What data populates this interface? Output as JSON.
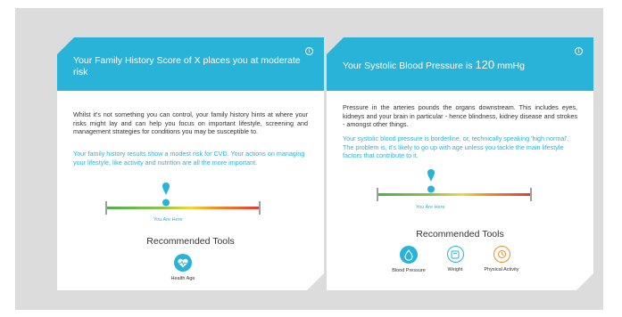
{
  "colors": {
    "accent": "#29b3d8",
    "panel_bg": "#dcdcdc",
    "card_bg": "#ffffff",
    "scale_start": "#4caf50",
    "scale_end": "#e53935",
    "tool_orange": "#f28c28"
  },
  "family_card": {
    "title": "Your Family History Score of X places you at moderate risk",
    "info_icon": "info-icon",
    "body": "Whilst it's not something you can control, your family history hints at where your risks might lay and can help you focus on important lifestyle, screening and management strategies for conditions you may be susceptible to.",
    "accent": "Your family history results show a modest risk for CVD. Your actions on managing your lifestyle, like activity and nutrition are all the more important.",
    "scale_position": 0.45,
    "marker_label": "You Are Here",
    "tools_heading": "Recommended Tools",
    "tools": [
      {
        "label": "Health Age",
        "icon": "heart-icon",
        "style": "filled"
      }
    ]
  },
  "bp_card": {
    "title_prefix": "Your Systolic Blood Pressure is",
    "value": "120",
    "unit": "mmHg",
    "info_icon": "info-icon",
    "body": "Pressure in the arteries pounds the organs downstream. This includes eyes, kidneys and your brain in particular - hence blindness, kidney disease and strokes - amongst other things.",
    "accent": "Your systolic blood pressure is borderline, or, technically speaking 'high normal'. The problem is, it's likely to go up with age unless you tackle the main lifestyle factors that contribute to it.",
    "scale_position": 0.35,
    "marker_label": "You Are Here",
    "tools_heading": "Recommended Tools",
    "tools": [
      {
        "label": "Blood Pressure",
        "icon": "blood-drop-icon",
        "style": "filled"
      },
      {
        "label": "Weight",
        "icon": "scale-icon",
        "style": "outline-blue"
      },
      {
        "label": "Physical Activity",
        "icon": "activity-icon",
        "style": "outline-orange"
      }
    ]
  }
}
